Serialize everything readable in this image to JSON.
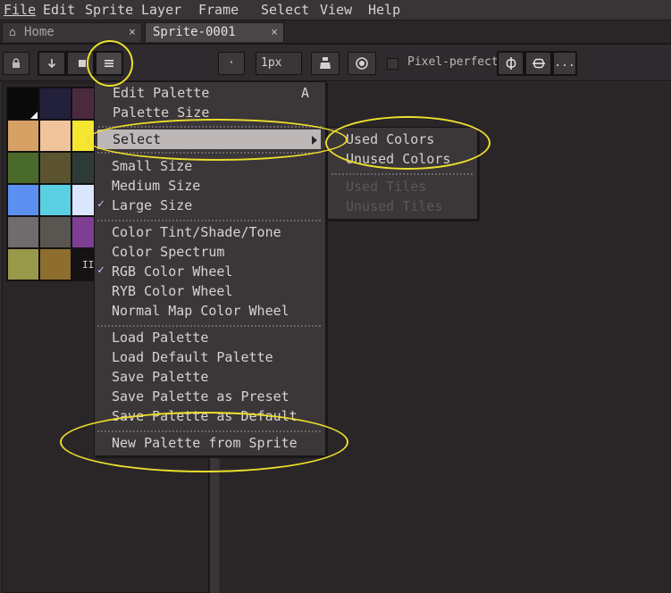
{
  "menubar": {
    "items": [
      {
        "label": "File"
      },
      {
        "label": "Edit"
      },
      {
        "label": "Sprite"
      },
      {
        "label": "Layer"
      },
      {
        "label": "Frame"
      },
      {
        "label": "Select"
      },
      {
        "label": "View"
      },
      {
        "label": "Help"
      }
    ]
  },
  "tabs": [
    {
      "label": "Home",
      "icon": "home-icon",
      "close": "×"
    },
    {
      "label": "Sprite-0001",
      "close": "×"
    }
  ],
  "toolbar": {
    "lock_icon": "lock-icon",
    "down_icon": "arrow-down-icon",
    "sort_icon": "sort-icon",
    "menu_icon": "hamburger-menu-icon",
    "brush_shape": "·",
    "brush_size": "1px",
    "ink_icon": "ink-bottle-icon",
    "opacity_icon": "opacity-icon",
    "pixel_perfect_label": "Pixel-perfect",
    "symmetry_icons": [
      "vertical-symmetry-icon",
      "horizontal-symmetry-icon"
    ],
    "more_label": "..."
  },
  "palette": {
    "swatches": [
      [
        "#0a0a0a",
        "#22203b",
        "#4c2a3e"
      ],
      [
        "#d7a065",
        "#f0c49b",
        "#f5e632"
      ],
      [
        "#4a6a2b",
        "#5c5430",
        "#2e3a35"
      ],
      [
        "#5b8ff0",
        "#5ad0e2",
        "#dbe6ff"
      ],
      [
        "#6e6c6c",
        "#595652",
        "#7e3e94"
      ],
      [
        "#99994a",
        "#8e6e2f"
      ]
    ],
    "resize_handle": "II"
  },
  "popup_menu": {
    "edit_palette": "Edit Palette",
    "edit_palette_shortcut": "A",
    "palette_size": "Palette Size",
    "select": "Select",
    "small_size": "Small Size",
    "medium_size": "Medium Size",
    "large_size": "Large Size",
    "color_tint": "Color Tint/Shade/Tone",
    "color_spectrum": "Color Spectrum",
    "rgb_wheel": "RGB Color Wheel",
    "ryb_wheel": "RYB Color Wheel",
    "normal_map_wheel": "Normal Map Color Wheel",
    "load_palette": "Load Palette",
    "load_default_palette": "Load Default Palette",
    "save_palette": "Save Palette",
    "save_palette_preset": "Save Palette as Preset",
    "save_palette_default": "Save Palette as Default",
    "new_palette_from_sprite": "New Palette from Sprite",
    "check_mark": "✓"
  },
  "submenu": {
    "used_colors": "Used Colors",
    "unused_colors": "Unused Colors",
    "used_tiles": "Used Tiles",
    "unused_tiles": "Unused Tiles"
  },
  "colors": {
    "annotation": "#ecdf2d",
    "highlight": "#bdb8b7"
  }
}
